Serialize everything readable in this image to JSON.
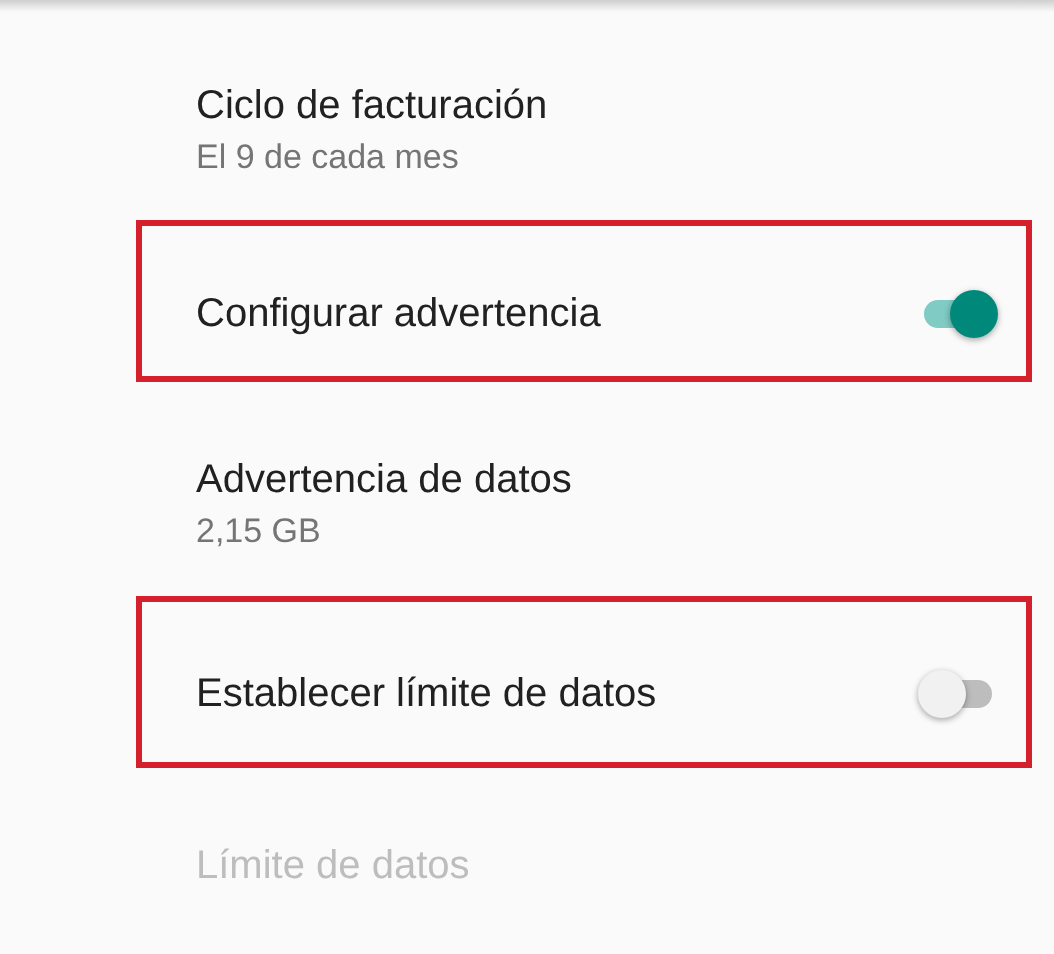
{
  "items": [
    {
      "kind": "info",
      "title": "Ciclo de facturación",
      "summary": "El 9 de cada mes",
      "disabled": false,
      "highlighted": false
    },
    {
      "kind": "switch",
      "title": "Configurar advertencia",
      "on": true,
      "disabled": false,
      "highlighted": true
    },
    {
      "kind": "info",
      "title": "Advertencia de datos",
      "summary": "2,15 GB",
      "disabled": false,
      "highlighted": false
    },
    {
      "kind": "switch",
      "title": "Establecer límite de datos",
      "on": false,
      "disabled": false,
      "highlighted": true
    },
    {
      "kind": "info",
      "title": "Límite de datos",
      "disabled": true,
      "highlighted": false
    }
  ]
}
